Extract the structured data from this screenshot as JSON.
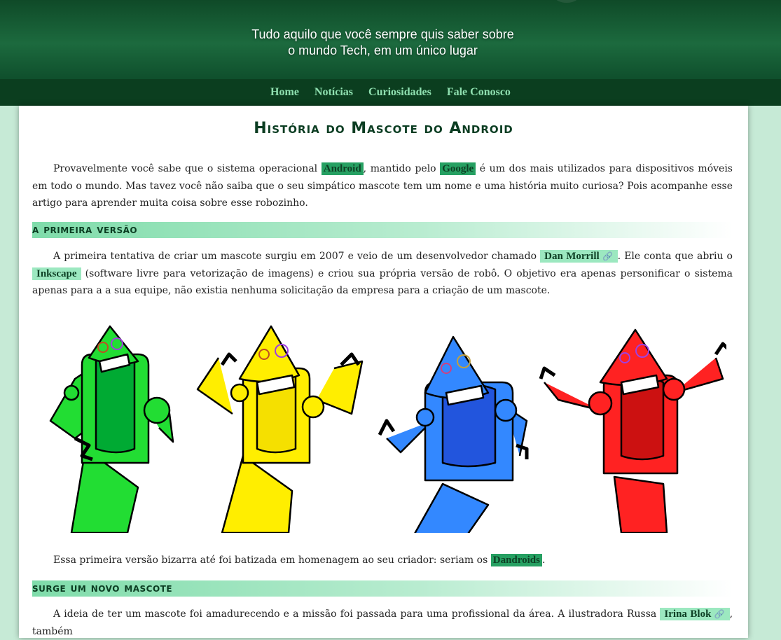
{
  "header": {
    "tagline_line1": "Tudo aquilo que você sempre quis saber sobre",
    "tagline_line2": "o mundo Tech, em um único lugar"
  },
  "nav": {
    "items": [
      {
        "label": "Home"
      },
      {
        "label": "Notícias"
      },
      {
        "label": "Curiosidades"
      },
      {
        "label": "Fale Conosco"
      }
    ]
  },
  "article": {
    "title": "História do Mascote do Android",
    "intro": {
      "t1": "Provavelmente você sabe que o sistema operacional ",
      "hl1": "Android",
      "t2": ", mantido pelo ",
      "hl2": "Google",
      "t3": " é um dos mais utilizados para dispositivos móveis em todo o mundo. Mas tavez você não saiba que o seu simpático mascote tem um nome e uma história muito curiosa? Pois acompanhe esse artigo para aprender muita coisa sobre esse robozinho."
    },
    "section1": {
      "heading": "A Primeira Versão",
      "p1": {
        "t1": "A primeira tentativa de criar um mascote surgiu em 2007 e veio de um desenvolvedor chamado ",
        "link1": "Dan Morrill",
        "t2": ". Ele conta que abriu o ",
        "link2": "Inkscape",
        "t3": " (software livre para vetorização de imagens) e criou sua própria versão de robô. O objetivo era apenas personificar o sistema apenas para a a sua equipe, não existia nenhuma solicitação da empresa para a criação de um mascote."
      },
      "p2": {
        "t1": "Essa primeira versão bizarra até foi batizada em homenagem ao seu criador: seriam os ",
        "hl": "Dandroids",
        "t2": "."
      }
    },
    "section2": {
      "heading": "Surge um Novo Mascote",
      "p1": {
        "t1": "A ideia de ter um mascote foi amadurecendo e a missão foi passada para uma profissional da área. A ilustradora Russa ",
        "link": "Irina Blok",
        "t2": ", também"
      }
    },
    "link_icon": "🔗",
    "robots": {
      "colors": [
        "#22dd33",
        "#ffee00",
        "#3388ff",
        "#ff2222"
      ],
      "icons": [
        "green-robot-icon",
        "yellow-robot-icon",
        "blue-robot-icon",
        "red-robot-icon"
      ]
    }
  }
}
